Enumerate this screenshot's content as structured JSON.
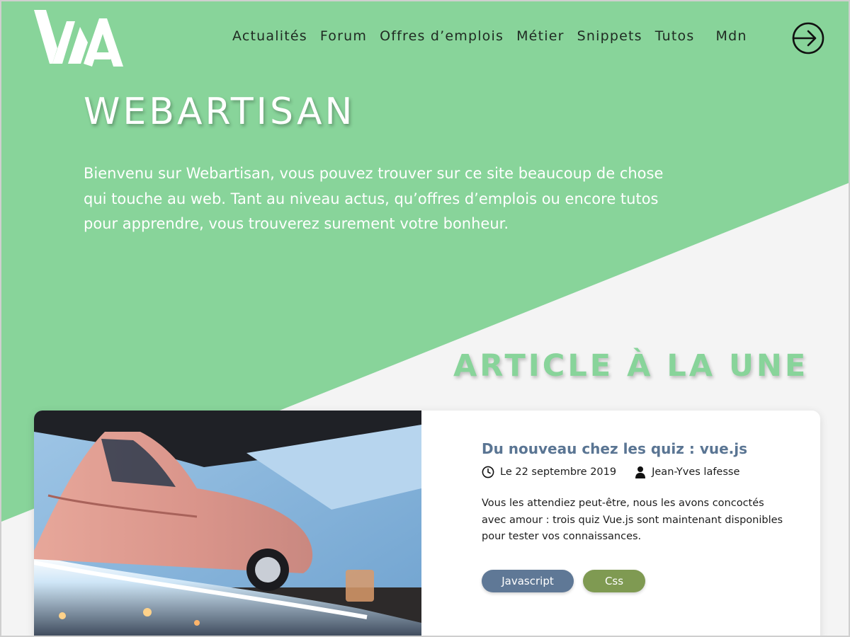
{
  "colors": {
    "brand_green": "#88d49a",
    "page_background": "#f4f4f4",
    "card_title": "#5a7593",
    "tag_javascript": "#5f7896",
    "tag_css": "#7f9a52"
  },
  "header": {
    "logo_text": "WA",
    "nav": [
      {
        "label": "Actualités"
      },
      {
        "label": "Forum"
      },
      {
        "label": "Offres d’emplois"
      },
      {
        "label": "Métier"
      },
      {
        "label": "Snippets"
      },
      {
        "label": "Tutos"
      },
      {
        "label": "Mdn"
      }
    ],
    "login_icon": "login-icon"
  },
  "hero": {
    "title": "WEBARTISAN",
    "intro": "Bienvenu sur Webartisan, vous pouvez trouver sur ce site beaucoup de chose qui touche au web. Tant au niveau actus, qu’offres d’emplois ou encore tutos pour apprendre, vous trouverez surement votre bonheur."
  },
  "featured": {
    "section_title": "ARTICLE À LA UNE",
    "article": {
      "title": "Du nouveau chez les quiz : vue.js",
      "date": "Le 22 septembre 2019",
      "author": "Jean-Yves lafesse",
      "excerpt": "Vous les attendiez peut-être, nous les avons concoctés avec amour : trois quiz Vue.js sont maintenant disponibles pour tester vos connaissances.",
      "tags": [
        {
          "label": "Javascript"
        },
        {
          "label": "Css"
        }
      ],
      "image": "vintage-car-photo",
      "date_icon": "clock-icon",
      "author_icon": "user-icon"
    }
  }
}
